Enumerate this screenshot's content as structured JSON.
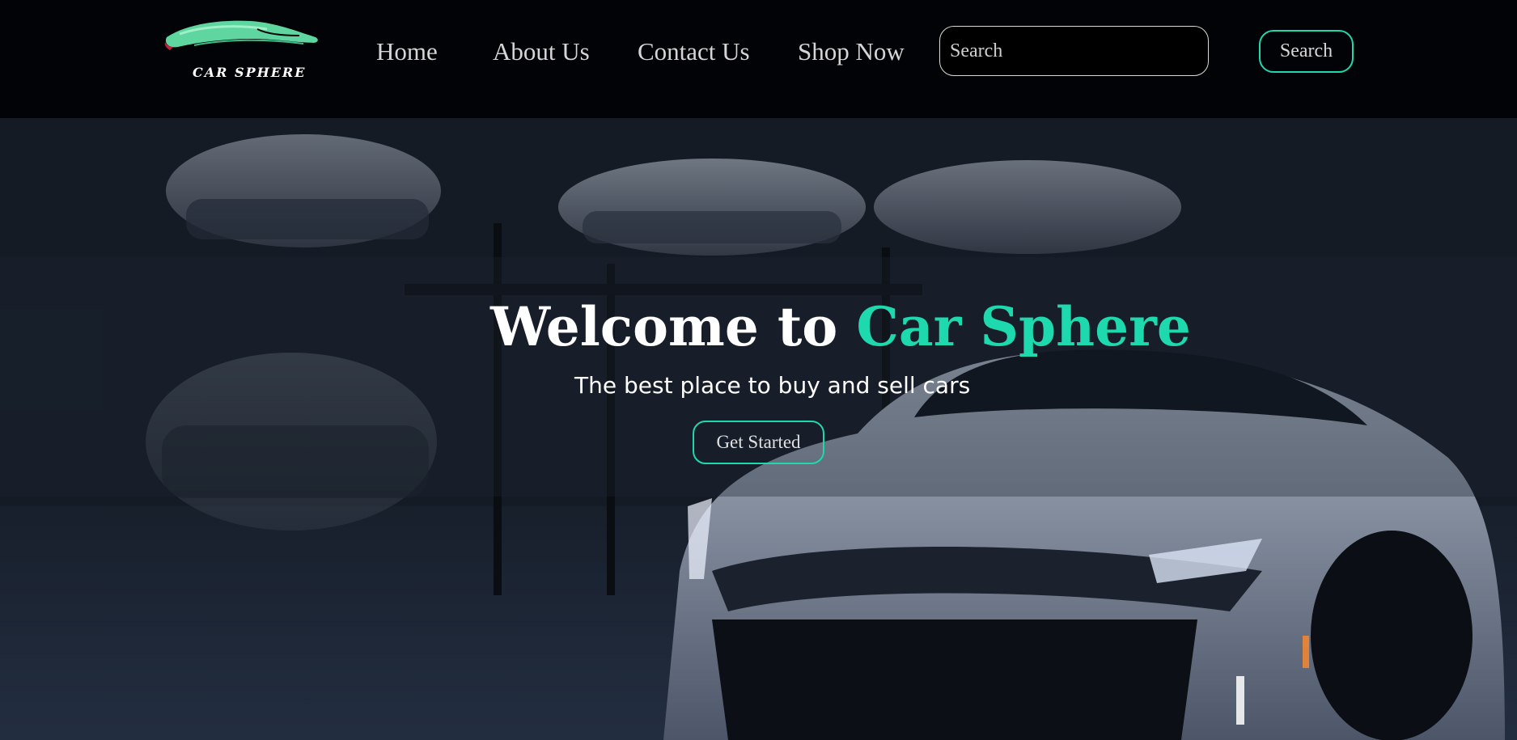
{
  "brand": {
    "logo_text": "CAR SPHERE",
    "accent_color": "#1ed8ae",
    "logo_color": "#5fd6a0"
  },
  "nav": {
    "items": [
      {
        "label": "Home"
      },
      {
        "label": "About Us"
      },
      {
        "label": "Contact Us"
      },
      {
        "label": "Shop Now"
      }
    ]
  },
  "search": {
    "placeholder": "Search",
    "button_label": "Search"
  },
  "hero": {
    "title_prefix": "Welcome to ",
    "title_accent": "Car Sphere",
    "subtitle": "The best place to buy and sell cars",
    "cta_label": "Get Started"
  },
  "colors": {
    "header_bg": "#020306",
    "hero_bg": "#121820",
    "text": "#ffffff"
  }
}
